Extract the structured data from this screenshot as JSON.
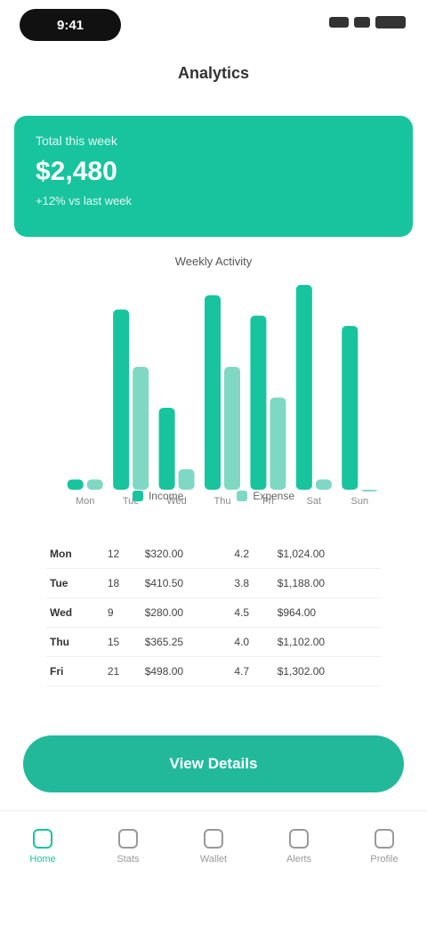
{
  "status": {
    "time": "9:41"
  },
  "page": {
    "title": "Analytics"
  },
  "summary": {
    "label": "Total this week",
    "value": "$2,480",
    "sub": "+12% vs last week"
  },
  "chart_data": {
    "type": "bar",
    "title": "Weekly Activity",
    "categories": [
      "Mon",
      "Tue",
      "Wed",
      "Thu",
      "Fri",
      "Sat",
      "Sun"
    ],
    "series": [
      {
        "name": "Income",
        "values": [
          5,
          88,
          40,
          95,
          85,
          100,
          80
        ]
      },
      {
        "name": "Expense",
        "values": [
          5,
          60,
          10,
          60,
          45,
          5,
          0
        ]
      }
    ],
    "ylim": [
      0,
      100
    ],
    "colors": [
      "#17c49e",
      "#7fd8c3"
    ]
  },
  "legend": [
    {
      "label": "Income",
      "color": "#17c49e"
    },
    {
      "label": "Expense",
      "color": "#7fd8c3"
    }
  ],
  "table": {
    "rows": [
      [
        "Mon",
        "12",
        "$320.00",
        "4.2",
        "$1,024.00"
      ],
      [
        "Tue",
        "18",
        "$410.50",
        "3.8",
        "$1,188.00"
      ],
      [
        "Wed",
        "9",
        "$280.00",
        "4.5",
        "$964.00"
      ],
      [
        "Thu",
        "15",
        "$365.25",
        "4.0",
        "$1,102.00"
      ],
      [
        "Fri",
        "21",
        "$498.00",
        "4.7",
        "$1,302.00"
      ]
    ]
  },
  "button": {
    "label": "View Details"
  },
  "tabs": [
    {
      "label": "Home",
      "icon": "home-icon",
      "active": true
    },
    {
      "label": "Stats",
      "icon": "chart-icon"
    },
    {
      "label": "Wallet",
      "icon": "wallet-icon"
    },
    {
      "label": "Alerts",
      "icon": "bell-icon"
    },
    {
      "label": "Profile",
      "icon": "user-icon"
    }
  ]
}
